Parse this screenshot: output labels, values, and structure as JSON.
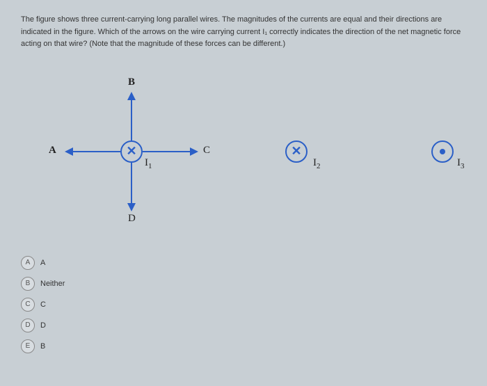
{
  "question": {
    "line1": "The figure shows three current-carrying long parallel wires. The magnitudes of the currents are equal and their directions are",
    "line2": "indicated in the figure. Which of the arrows on the wire carrying current I₁ correctly indicates the direction of the net magnetic force",
    "line3": "acting on that wire? (Note that the magnitude of these forces can be different.)"
  },
  "arrows": {
    "a": "A",
    "b": "B",
    "c": "C",
    "d": "D"
  },
  "wires": {
    "i1": "I",
    "i1_sub": "1",
    "i2": "I",
    "i2_sub": "2",
    "i3": "I",
    "i3_sub": "3"
  },
  "options": {
    "a_letter": "A",
    "a_text": "A",
    "b_letter": "B",
    "b_text": "Neither",
    "c_letter": "C",
    "c_text": "C",
    "d_letter": "D",
    "d_text": "D",
    "e_letter": "E",
    "e_text": "B"
  }
}
